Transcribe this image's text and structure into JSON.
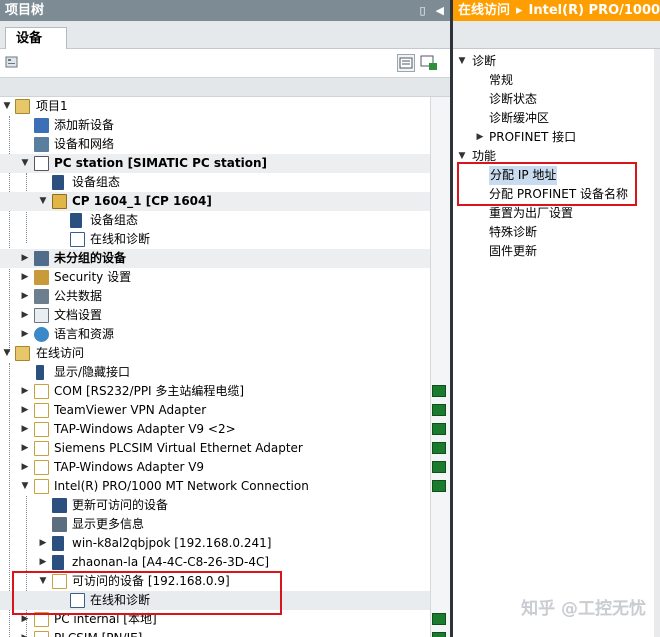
{
  "left_panel": {
    "title": "项目树",
    "ctrl_pin": "▯",
    "ctrl_collapse": "◀",
    "tab": "设备"
  },
  "tree": [
    {
      "label": "项目1",
      "exp": "▼",
      "bold": false
    },
    {
      "label": "添加新设备",
      "exp": "",
      "bold": false
    },
    {
      "label": "设备和网络",
      "exp": "",
      "bold": false
    },
    {
      "label": "PC station [SIMATIC PC station]",
      "exp": "▼",
      "bold": true
    },
    {
      "label": "设备组态",
      "exp": "",
      "bold": false
    },
    {
      "label": "CP 1604_1 [CP 1604]",
      "exp": "▼",
      "bold": true
    },
    {
      "label": "设备组态",
      "exp": "",
      "bold": false
    },
    {
      "label": "在线和诊断",
      "exp": "",
      "bold": false
    },
    {
      "label": "未分组的设备",
      "exp": "▶",
      "bold": true
    },
    {
      "label": "Security 设置",
      "exp": "▶",
      "bold": false
    },
    {
      "label": "公共数据",
      "exp": "▶",
      "bold": false
    },
    {
      "label": "文档设置",
      "exp": "▶",
      "bold": false
    },
    {
      "label": "语言和资源",
      "exp": "▶",
      "bold": false
    },
    {
      "label": "在线访问",
      "exp": "▼",
      "bold": false
    },
    {
      "label": "显示/隐藏接口",
      "exp": "",
      "bold": false
    },
    {
      "label": "COM [RS232/PPI 多主站编程电缆]",
      "exp": "▶",
      "bold": false
    },
    {
      "label": "TeamViewer VPN Adapter",
      "exp": "▶",
      "bold": false
    },
    {
      "label": "TAP-Windows Adapter V9 <2>",
      "exp": "▶",
      "bold": false
    },
    {
      "label": "Siemens PLCSIM Virtual Ethernet Adapter",
      "exp": "▶",
      "bold": false
    },
    {
      "label": "TAP-Windows Adapter V9",
      "exp": "▶",
      "bold": false
    },
    {
      "label": "Intel(R) PRO/1000 MT Network Connection",
      "exp": "▼",
      "bold": false
    },
    {
      "label": "更新可访问的设备",
      "exp": "",
      "bold": false
    },
    {
      "label": "显示更多信息",
      "exp": "",
      "bold": false
    },
    {
      "label": "win-k8al2qbjpok [192.168.0.241]",
      "exp": "▶",
      "bold": false
    },
    {
      "label": "zhaonan-la [A4-4C-C8-26-3D-4C]",
      "exp": "▶",
      "bold": false
    },
    {
      "label": "可访问的设备 [192.168.0.9]",
      "exp": "▼",
      "bold": false
    },
    {
      "label": "在线和诊断",
      "exp": "",
      "bold": false
    },
    {
      "label": "PC internal [本地]",
      "exp": "▶",
      "bold": false
    },
    {
      "label": "PLCSIM [PN/IE]",
      "exp": "▶",
      "bold": false
    }
  ],
  "right_panel": {
    "title_a": "在线访问",
    "title_sep": "▸",
    "title_b": "Intel(R) PRO/1000"
  },
  "right_tree": [
    {
      "label": "诊断",
      "exp": "▼"
    },
    {
      "label": "常规",
      "exp": ""
    },
    {
      "label": "诊断状态",
      "exp": ""
    },
    {
      "label": "诊断缓冲区",
      "exp": ""
    },
    {
      "label": "PROFINET 接口",
      "exp": "▶"
    },
    {
      "label": "功能",
      "exp": "▼"
    },
    {
      "label": "分配 IP 地址",
      "exp": ""
    },
    {
      "label": "分配 PROFINET 设备名称",
      "exp": ""
    },
    {
      "label": "重置为出厂设置",
      "exp": ""
    },
    {
      "label": "特殊诊断",
      "exp": ""
    },
    {
      "label": "固件更新",
      "exp": ""
    }
  ],
  "watermark": "知乎 @工控无忧"
}
